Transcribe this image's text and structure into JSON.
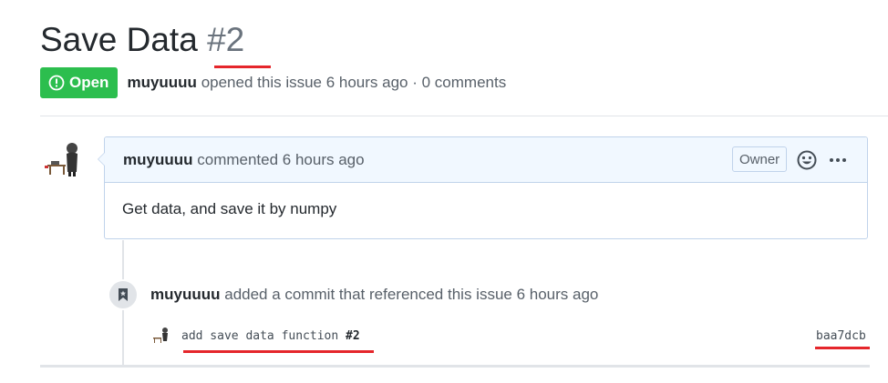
{
  "issue": {
    "title": "Save Data",
    "number": "#2",
    "state": "Open",
    "state_color": "#2cbe4e",
    "author": "muyuuuu",
    "meta_text": "opened this issue 6 hours ago · 0 comments"
  },
  "comment": {
    "author": "muyuuuu",
    "action": "commented 6 hours ago",
    "badge": "Owner",
    "body": "Get data, and save it by numpy",
    "icons": [
      "smiley-icon",
      "kebab-menu-icon"
    ]
  },
  "event": {
    "author": "muyuuuu",
    "text": "added a commit that referenced this issue 6 hours ago",
    "icon": "bookmark-icon",
    "commit_message": "add save data function",
    "commit_ref": "#2",
    "commit_sha": "baa7dcb"
  },
  "annotation_color": "#e5262b"
}
